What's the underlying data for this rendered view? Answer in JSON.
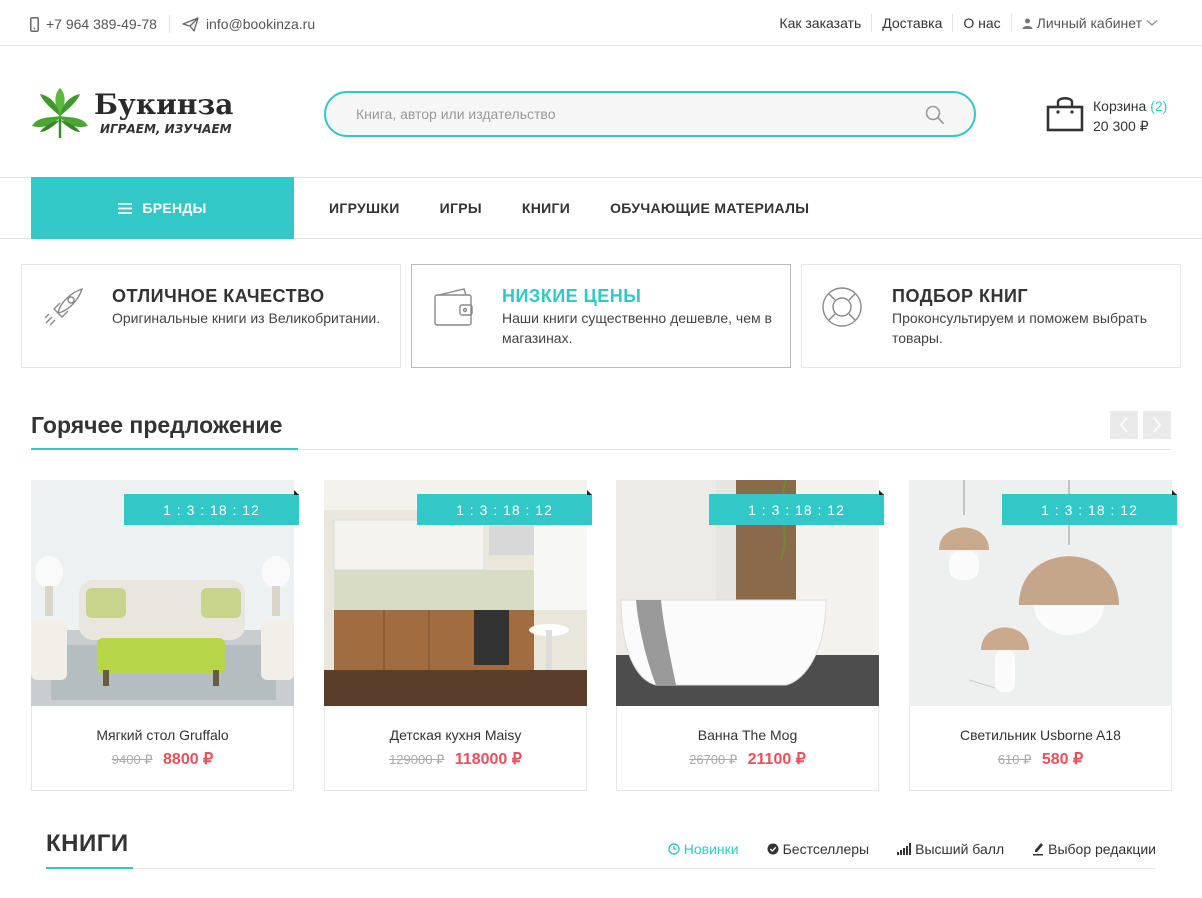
{
  "topbar": {
    "phone": "+7 964 389-49-78",
    "email": "info@bookinza.ru",
    "links": [
      "Как заказать",
      "Доставка",
      "О нас"
    ],
    "cabinet": "Личный кабинет"
  },
  "header": {
    "logo_title": "Букинза",
    "logo_slogan": "ИГРАЕМ, ИЗУЧАЕМ",
    "search_placeholder": "Книга, автор или издательство",
    "cart_label": "Корзина",
    "cart_count": "(2)",
    "cart_sum": "20 300 ₽"
  },
  "nav": {
    "brands": "БРЕНДЫ",
    "items": [
      "ИГРУШКИ",
      "ИГРЫ",
      "КНИГИ",
      "ОБУЧАЮЩИЕ МАТЕРИАЛЫ"
    ]
  },
  "features": [
    {
      "title": "ОТЛИЧНОЕ КАЧЕСТВО",
      "text": "Оригинальные книги из Великобритании.",
      "icon": "rocket-icon"
    },
    {
      "title": "НИЗКИЕ ЦЕНЫ",
      "text": "Наши книги существенно дешевле, чем в магазинах.",
      "icon": "wallet-icon"
    },
    {
      "title": "ПОДБОР КНИГ",
      "text": "Проконсультируем и поможем выбрать товары.",
      "icon": "lifebuoy-icon"
    }
  ],
  "hot": {
    "title": "Горячее предложение",
    "products": [
      {
        "name": "Мягкий стол Gruffalo",
        "old": "9400 ₽",
        "new": "8800 ₽",
        "timer": "1 : 3 : 18 : 12"
      },
      {
        "name": "Детская кухня Maisy",
        "old": "129000 ₽",
        "new": "118000 ₽",
        "timer": "1 : 3 : 18 : 12"
      },
      {
        "name": "Ванна The Mog",
        "old": "26700 ₽",
        "new": "21100 ₽",
        "timer": "1 : 3 : 18 : 12"
      },
      {
        "name": "Светильник Usborne A18",
        "old": "610 ₽",
        "new": "580 ₽",
        "timer": "1 : 3 : 18 : 12"
      }
    ]
  },
  "books": {
    "title": "КНИГИ",
    "tabs": [
      "Новинки",
      "Бестселлеры",
      "Высший балл",
      "Выбор редакции"
    ]
  },
  "colors": {
    "accent": "#32c8c8",
    "price": "#e8505b"
  }
}
